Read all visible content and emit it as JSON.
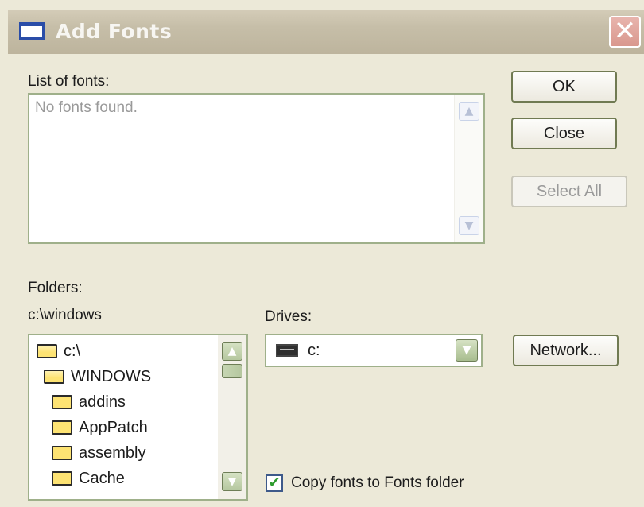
{
  "window": {
    "title": "Add Fonts",
    "close_glyph": "✕"
  },
  "fonts": {
    "label": "List of fonts:",
    "empty_text": "No fonts found."
  },
  "buttons": {
    "ok": "OK",
    "close": "Close",
    "select_all": "Select All",
    "network": "Network..."
  },
  "folders": {
    "label": "Folders:",
    "current_path": "c:\\windows",
    "items": [
      {
        "name": "c:\\",
        "icon": "open-folder-icon"
      },
      {
        "name": "WINDOWS",
        "icon": "open-folder-icon"
      },
      {
        "name": "addins",
        "icon": "folder-icon"
      },
      {
        "name": "AppPatch",
        "icon": "folder-icon"
      },
      {
        "name": "assembly",
        "icon": "folder-icon"
      },
      {
        "name": "Cache",
        "icon": "folder-icon"
      }
    ]
  },
  "drives": {
    "label": "Drives:",
    "selected": "c:"
  },
  "copy_option": {
    "label": "Copy fonts to Fonts folder",
    "checked": true
  },
  "colors": {
    "accent": "#9fb08a",
    "title_bar": "#c6bea8",
    "close": "#d9988e"
  }
}
